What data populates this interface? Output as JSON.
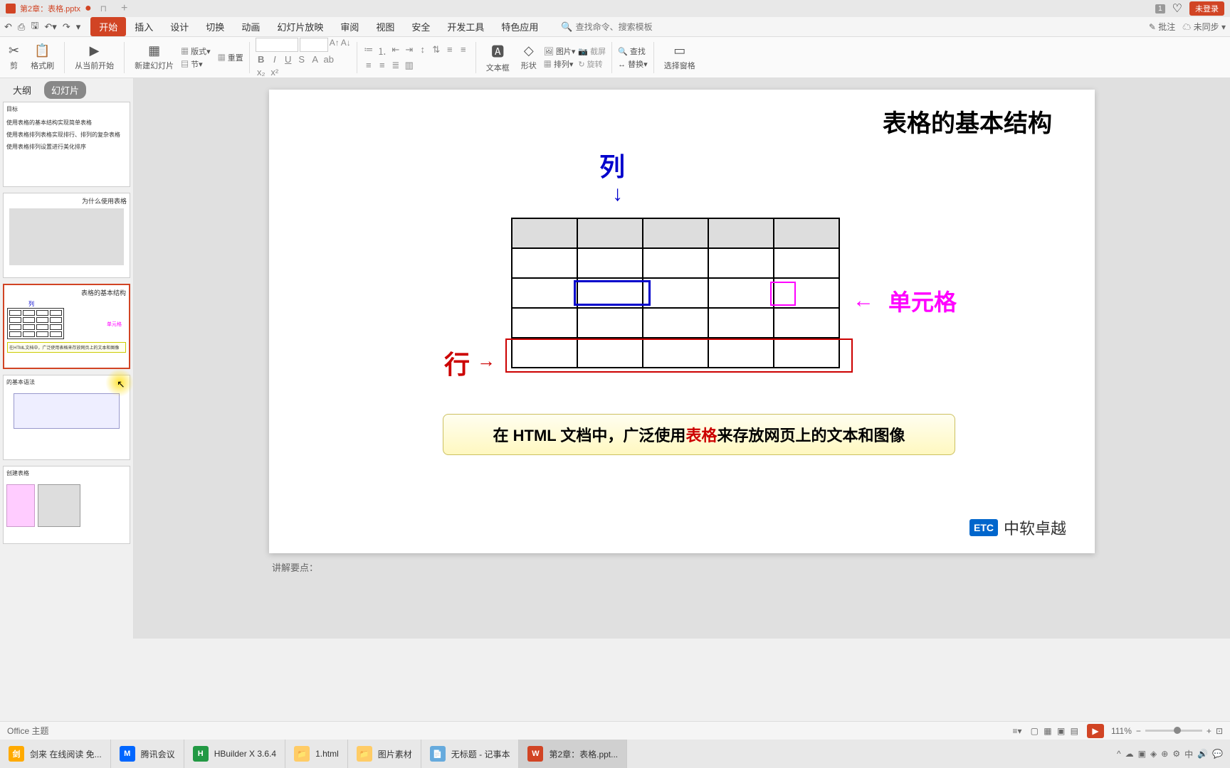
{
  "titlebar": {
    "doc_title": "第2章：表格.pptx",
    "modified_dot": "●",
    "one_badge": "1",
    "login": "未登录"
  },
  "menubar": {
    "tabs": [
      "开始",
      "插入",
      "设计",
      "切换",
      "动画",
      "幻灯片放映",
      "审阅",
      "视图",
      "安全",
      "开发工具",
      "特色应用"
    ],
    "search_placeholder": "查找命令、搜索模板",
    "right": {
      "approve": "批注",
      "sync": "未同步"
    }
  },
  "ribbon": {
    "format_painter": "格式刷",
    "from_current": "从当前开始",
    "new_slide": "新建幻灯片",
    "layout": "版式",
    "section": "节",
    "reset": "重置",
    "textbox": "文本框",
    "shape": "形状",
    "picture": "图片",
    "screenshot": "截屏",
    "arrange": "排列",
    "rotate": "旋转",
    "find": "查找",
    "replace": "替换",
    "select_pane": "选择窗格"
  },
  "panel": {
    "outline": "大纲",
    "slides": "幻灯片",
    "thumb1_text1": "目标",
    "thumb1_text2": "使用表格的基本结构实现简单表格",
    "thumb1_text3": "使用表格排列表格实现排行、排列的复杂表格",
    "thumb1_text4": "使用表格排列设置进行美化排序",
    "thumb2_title": "为什么使用表格",
    "thumb3_title": "表格的基本结构",
    "thumb3_col": "列",
    "thumb3_cell": "单元格",
    "thumb3_bottom": "在HTML文档中，广泛使用表格来存放网页上的文本和图像",
    "thumb4_title": "的基本语法",
    "thumb5_title": "创建表格"
  },
  "slide": {
    "title": "表格的基本结构",
    "col_label": "列",
    "row_label": "行",
    "cell_label": "单元格",
    "callout_part1": "在 HTML 文档中，广泛使用",
    "callout_red": "表格",
    "callout_part2": "来存放网页上的文本和图像",
    "etc_badge": "ETC",
    "etc_text": "中软卓越"
  },
  "notes": "讲解要点：",
  "statusbar": {
    "theme": "Office 主题",
    "zoom": "111%"
  },
  "taskbar": {
    "items": [
      {
        "label": "剑来 在线阅读 免...",
        "color": "#ffaa00"
      },
      {
        "label": "腾讯会议",
        "color": "#0066ff"
      },
      {
        "label": "HBuilder X 3.6.4",
        "color": "#229944"
      },
      {
        "label": "1.html",
        "color": "#ffcc66"
      },
      {
        "label": "图片素材",
        "color": "#ffcc66"
      },
      {
        "label": "无标题 - 记事本",
        "color": "#66aadd"
      },
      {
        "label": "第2章：表格.ppt...",
        "color": "#d14424"
      }
    ]
  },
  "chart_data": {
    "type": "table",
    "title": "表格的基本结构",
    "rows": 5,
    "cols": 5,
    "labels": {
      "column": "列",
      "row": "行",
      "cell": "单元格"
    },
    "callout": "在 HTML 文档中，广泛使用表格来存放网页上的文本和图像"
  }
}
